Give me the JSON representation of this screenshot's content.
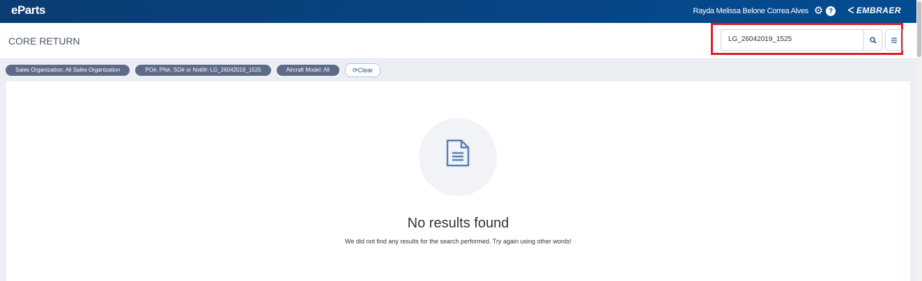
{
  "app": {
    "logo": "eParts",
    "user": "Rayda Melissa Belone Correa Alves",
    "brand": "EMBRAER"
  },
  "page": {
    "title": "CORE RETURN"
  },
  "search": {
    "value": "LG_26042019_1525"
  },
  "filters": [
    {
      "label": "Sales Organization: All Sales Organization"
    },
    {
      "label": "PO#, PN#, SO# or Notif#: LG_26042019_1525"
    },
    {
      "label": "Aircraft Model: All"
    }
  ],
  "clear_label": "Clear",
  "empty": {
    "title": "No results found",
    "message": "We did not find any results for the search performed. Try again using other words!"
  }
}
